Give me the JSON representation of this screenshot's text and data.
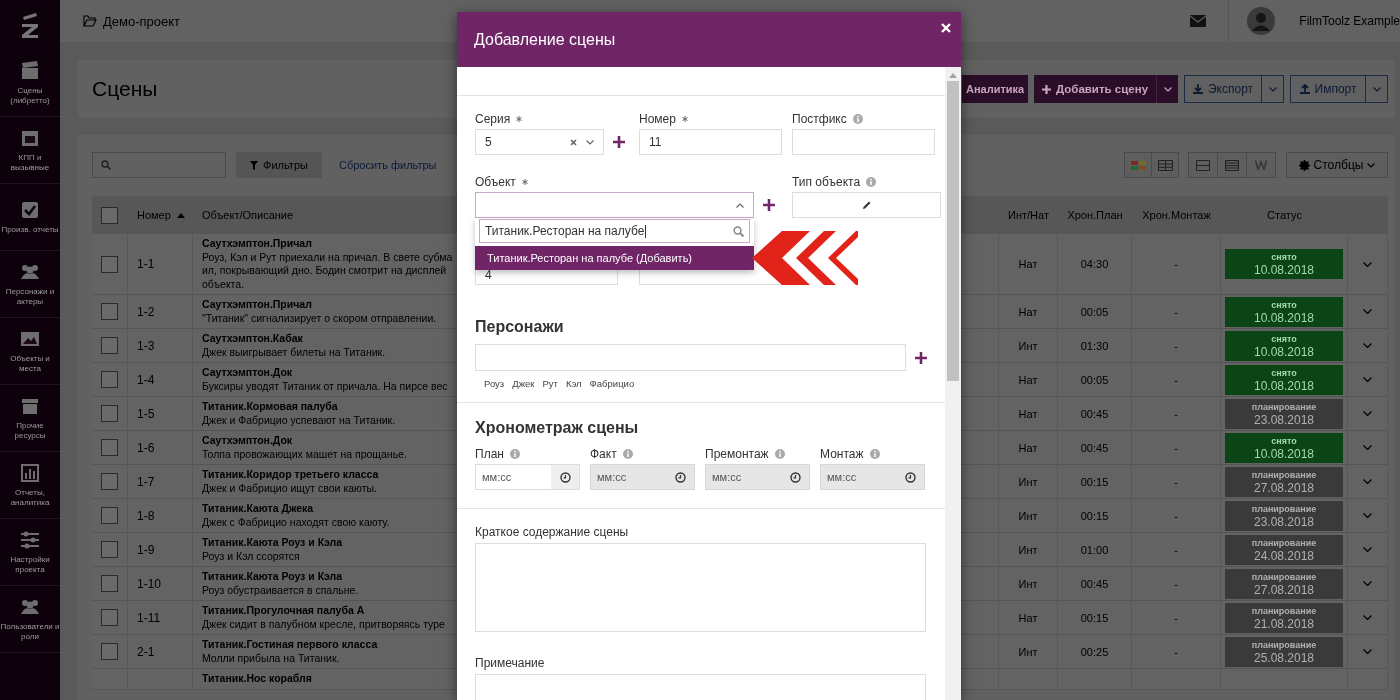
{
  "sidebar": {
    "items": [
      {
        "label": "Сцены (либретто)"
      },
      {
        "label": "КПП и вызывные"
      },
      {
        "label": "Произв. отчеты"
      },
      {
        "label": "Персонажи и актеры"
      },
      {
        "label": "Объекты и места"
      },
      {
        "label": "Прочие ресурсы"
      },
      {
        "label": "Отчеты, аналитика"
      },
      {
        "label": "Настройки проекта"
      },
      {
        "label": "Пользователи и роли"
      }
    ]
  },
  "topbar": {
    "project": "Демо-проект",
    "user": "FilmToolz Example"
  },
  "page": {
    "title": "Сцены",
    "actions": [
      {
        "label": "Аналитика",
        "kind": "primary",
        "split": false
      },
      {
        "label": "Добавить сцену",
        "kind": "primary",
        "split": true
      },
      {
        "label": "Экспорт",
        "kind": "outline",
        "split": true
      },
      {
        "label": "Импорт",
        "kind": "outline",
        "split": true
      }
    ]
  },
  "filters": {
    "filter_button": "Фильтры",
    "reset_link": "Сбросить фильтры",
    "columns_button": "Столбцы"
  },
  "table": {
    "all_checked": false,
    "columns": [
      {
        "label": "Номер",
        "sorted": true
      },
      {
        "label": "Объект/Описание",
        "sorted": false
      },
      {
        "label": "Инт/Нат",
        "sorted": false
      },
      {
        "label": "Хрон.План",
        "sorted": false
      },
      {
        "label": "Хрон.Монтаж",
        "sorted": false
      },
      {
        "label": "Статус",
        "sorted": false
      }
    ],
    "rows": [
      {
        "checked": false,
        "number": "1-1",
        "object": "Саутхэмптон.Причал",
        "description": [
          "Роуз, Кэл и Рут приехали на причал. В свете субма",
          "ил, покрывающий дно. Бодин смотрит на дисплей",
          "объекта."
        ],
        "int_nat": "Нат",
        "plan": "04:30",
        "montage": "-",
        "kind": "shot",
        "status_label": "снято",
        "status_date": "10.08.2018"
      },
      {
        "checked": false,
        "number": "1-2",
        "object": "Саутхэмптон.Причал",
        "description": [
          "\"Титаник\" сигнализирует о скором отправлении."
        ],
        "int_nat": "Нат",
        "plan": "00:05",
        "montage": "-",
        "kind": "shot",
        "status_label": "снято",
        "status_date": "10.08.2018"
      },
      {
        "checked": false,
        "number": "1-3",
        "object": "Саутхэмптон.Кабак",
        "description": [
          "Джек выигрывает билеты на Титаник."
        ],
        "int_nat": "Инт",
        "plan": "01:30",
        "montage": "-",
        "kind": "shot",
        "status_label": "снято",
        "status_date": "10.08.2018"
      },
      {
        "checked": false,
        "number": "1-4",
        "object": "Саутхэмптон.Док",
        "description": [
          "Буксиры уводят Титаник от причала. На пирсе вес"
        ],
        "int_nat": "Нат",
        "plan": "00:05",
        "montage": "-",
        "kind": "shot",
        "status_label": "снято",
        "status_date": "10.08.2018"
      },
      {
        "checked": false,
        "number": "1-5",
        "object": "Титаник.Кормовая палуба",
        "description": [
          "Джек и Фабрицио успевают на Титаник."
        ],
        "int_nat": "Нат",
        "plan": "00:45",
        "montage": "-",
        "kind": "planning",
        "status_label": "планирование",
        "status_date": "23.08.2018"
      },
      {
        "checked": false,
        "number": "1-6",
        "object": "Саутхэмптон.Док",
        "description": [
          "Толпа провожающих машет на прощанье."
        ],
        "int_nat": "Нат",
        "plan": "00:45",
        "montage": "-",
        "kind": "shot",
        "status_label": "снято",
        "status_date": "10.08.2018"
      },
      {
        "checked": false,
        "number": "1-7",
        "object": "Титаник.Коридор третьего класса",
        "description": [
          "Джек и Фабрицио ищут свои каюты."
        ],
        "int_nat": "Инт",
        "plan": "00:15",
        "montage": "-",
        "kind": "planning",
        "status_label": "планирование",
        "status_date": "27.08.2018"
      },
      {
        "checked": false,
        "number": "1-8",
        "object": "Титаник.Каюта Джека",
        "description": [
          "Джек с Фабрицио находят свою каюту."
        ],
        "int_nat": "Инт",
        "plan": "00:15",
        "montage": "-",
        "kind": "planning",
        "status_label": "планирование",
        "status_date": "23.08.2018"
      },
      {
        "checked": false,
        "number": "1-9",
        "object": "Титаник.Каюта Роуз и Кэла",
        "description": [
          "Роуз и Кэл ссорятся"
        ],
        "int_nat": "Инт",
        "plan": "01:00",
        "montage": "-",
        "kind": "planning",
        "status_label": "планирование",
        "status_date": "24.08.2018"
      },
      {
        "checked": false,
        "number": "1-10",
        "object": "Титаник.Каюта Роуз и Кэла",
        "description": [
          "Роуз обустраивается в спальне."
        ],
        "int_nat": "Инт",
        "plan": "00:45",
        "montage": "-",
        "kind": "planning",
        "status_label": "планирование",
        "status_date": "27.08.2018"
      },
      {
        "checked": false,
        "number": "1-11",
        "object": "Титаник.Прогулочная палуба А",
        "description": [
          "Джек сидит в палубном кресле, притворяясь туре"
        ],
        "int_nat": "Нат",
        "plan": "00:15",
        "montage": "-",
        "kind": "planning",
        "status_label": "планирование",
        "status_date": "21.08.2018"
      },
      {
        "checked": false,
        "number": "2-1",
        "object": "Титаник.Гостиная первого класса",
        "description": [
          "Молли прибыла на Титаник."
        ],
        "int_nat": "Инт",
        "plan": "00:25",
        "montage": "-",
        "kind": "planning",
        "status_label": "планирование",
        "status_date": "25.08.2018"
      },
      {
        "object": "Титаник.Нос корабля"
      }
    ]
  },
  "modal": {
    "title": "Добавление сцены",
    "series": {
      "label": "Серия",
      "required": true,
      "info": false,
      "value": "5"
    },
    "number": {
      "label": "Номер",
      "required": true,
      "info": false,
      "value": "11"
    },
    "postfix": {
      "label": "Постфикс",
      "required": false,
      "info": true
    },
    "object": {
      "label": "Объект",
      "required": true,
      "info": false,
      "expanded": true,
      "search_value": "Титаник.Ресторан на палубе",
      "options": [
        {
          "label": "Титаник.Ресторан на палубе (Добавить)",
          "selected": true
        }
      ]
    },
    "object_type": {
      "label": "Тип объекта",
      "required": false,
      "info": true
    },
    "covered_row": {
      "value": "4"
    },
    "characters": {
      "title": "Персонажи",
      "suggestions": [
        "Роуз",
        "Джек",
        "Рут",
        "Кэл",
        "Фабрицио"
      ]
    },
    "timing": {
      "title": "Хронометраж сцены",
      "fields": [
        {
          "label": "План",
          "placeholder": "мм:сс",
          "disabled": false
        },
        {
          "label": "Факт",
          "placeholder": "мм:сс",
          "disabled": true
        },
        {
          "label": "Премонтаж",
          "placeholder": "мм:сс",
          "disabled": true
        },
        {
          "label": "Монтаж",
          "placeholder": "мм:сс",
          "disabled": true
        }
      ]
    },
    "summary": {
      "label": "Краткое содержание сцены"
    },
    "note": {
      "label": "Примечание"
    }
  }
}
